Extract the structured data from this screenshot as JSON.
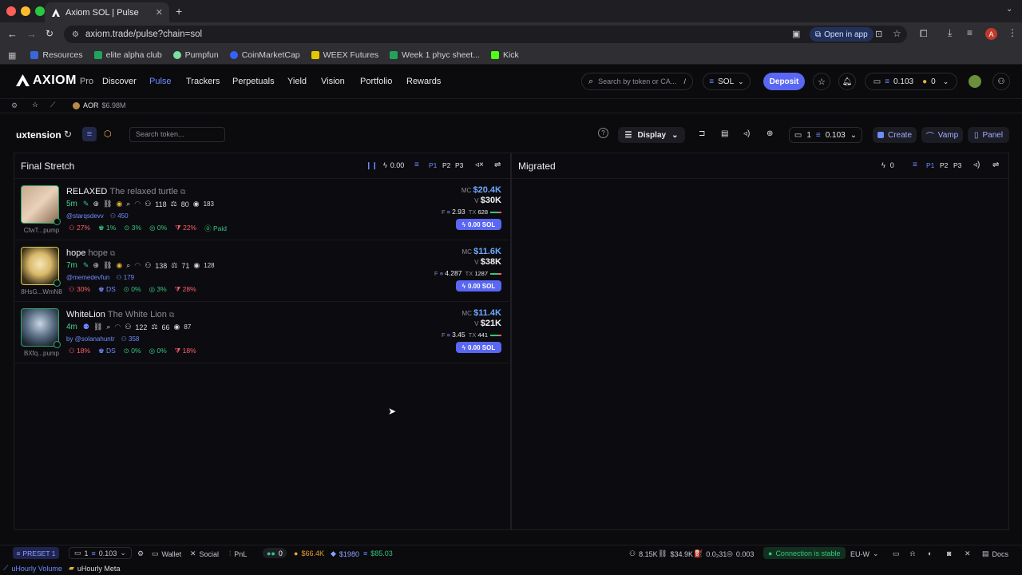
{
  "browser": {
    "tab_title": "Axiom SOL | Pulse",
    "url": "axiom.trade/pulse?chain=sol",
    "open_in_app": "Open in app",
    "avatar_letter": "A",
    "bookmarks": [
      "Resources",
      "elite alpha club",
      "Pumpfun",
      "CoinMarketCap",
      "WEEX Futures",
      "Week 1 phyc sheet...",
      "Kick"
    ]
  },
  "app": {
    "logo": "AXIOM",
    "logo_sub": "Pro",
    "nav": [
      "Discover",
      "Pulse",
      "Trackers",
      "Perpetuals",
      "Yield",
      "Vision",
      "Portfolio",
      "Rewards"
    ],
    "active_nav": "Pulse",
    "search_placeholder": "Search by token or CA...",
    "search_shortcut": "/",
    "chain": "SOL",
    "deposit": "Deposit",
    "balance": "0.103",
    "points": "0",
    "accent": "#5a67f2"
  },
  "subbar": {
    "ticker": "AOR",
    "ticker_value": "$6.98M"
  },
  "header": {
    "title": "uxtension",
    "search_placeholder": "Search token...",
    "display": "Display",
    "wallet_count": "1",
    "wallet_balance": "0.103",
    "create": "Create",
    "vamp": "Vamp",
    "panel": "Panel"
  },
  "final_stretch": {
    "title": "Final Stretch",
    "quick_amount": "0.00",
    "presets": [
      "P1",
      "P2",
      "P3"
    ],
    "tokens": [
      {
        "ticker": "RELAXED",
        "name": "The relaxed turtle",
        "age": "5m",
        "holders": "118",
        "pro": "80",
        "views": "183",
        "dev": "@starqsdevv",
        "followers": "450",
        "addr": "CfwT...pump",
        "top10": "27%",
        "dev_hold": "1%",
        "snipers": "3%",
        "insiders": "0%",
        "bundle": "22%",
        "extra": "Paid",
        "mc": "$20.4K",
        "vol": "$30K",
        "fee": "2.93",
        "tx": "628",
        "buy": "0.00 SOL"
      },
      {
        "ticker": "hope",
        "name": "hope",
        "age": "7m",
        "holders": "138",
        "pro": "71",
        "views": "128",
        "dev": "@memedevfun",
        "followers": "179",
        "addr": "8HsG...WmN8",
        "top10": "30%",
        "dev_hold": "DS",
        "snipers": "0%",
        "insiders": "3%",
        "bundle": "28%",
        "extra": "",
        "mc": "$11.6K",
        "vol": "$38K",
        "fee": "4.287",
        "tx": "1287",
        "buy": "0.00 SOL"
      },
      {
        "ticker": "WhiteLion",
        "name": "The White Lion",
        "age": "4m",
        "holders": "122",
        "pro": "66",
        "views": "87",
        "dev": "by @solanahuntr",
        "followers": "358",
        "addr": "BXfq...pump",
        "top10": "18%",
        "dev_hold": "DS",
        "snipers": "0%",
        "insiders": "0%",
        "bundle": "18%",
        "extra": "",
        "mc": "$11.4K",
        "vol": "$21K",
        "fee": "3.45",
        "tx": "441",
        "buy": "0.00 SOL"
      }
    ]
  },
  "migrated": {
    "title": "Migrated",
    "quick_amount": "0",
    "presets": [
      "P1",
      "P2",
      "P3"
    ]
  },
  "footer": {
    "preset": "PRESET 1",
    "wallets": "1",
    "balance": "0.103",
    "wallet": "Wallet",
    "social": "Social",
    "pnl": "PnL",
    "toggle_count": "0",
    "btc": "$66.4K",
    "eth": "$1980",
    "sol": "$85.03",
    "users": "8.15K",
    "volume": "$34.9K",
    "gas": "0.0₂31",
    "fee": "0.003",
    "connection": "Connection is stable",
    "region": "EU-W",
    "docs": "Docs",
    "hourly_volume": "uHourly Volume",
    "hourly_meta": "uHourly Meta"
  }
}
